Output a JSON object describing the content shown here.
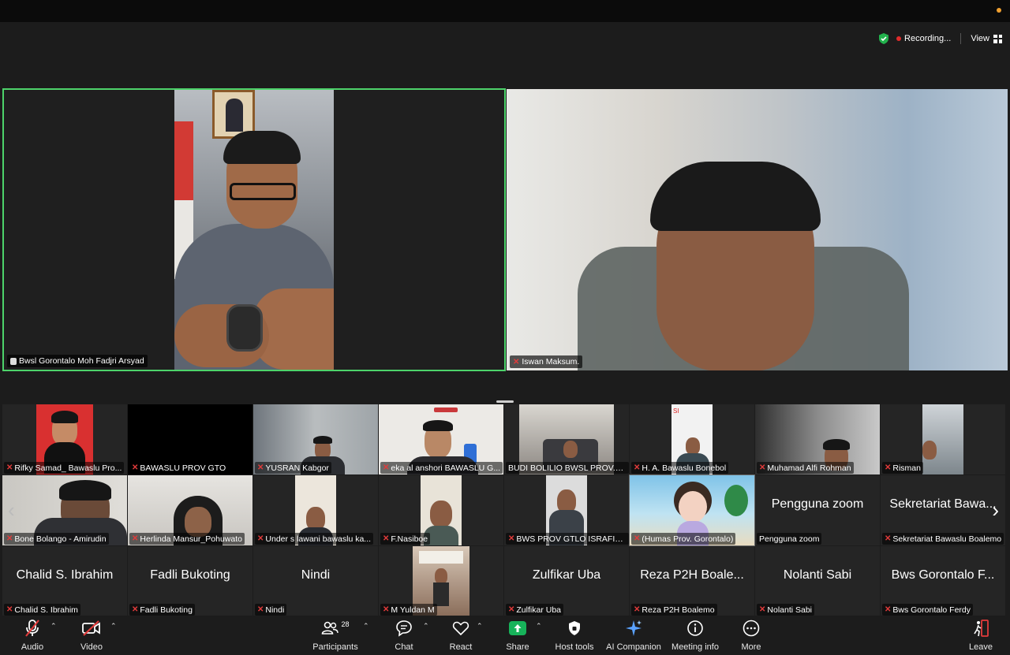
{
  "status": {
    "recording": "Recording...",
    "view": "View"
  },
  "speakers": {
    "left": {
      "name": "Bwsl Gorontalo Moh Fadjri Arsyad"
    },
    "right": {
      "name": "Iswan Maksum."
    }
  },
  "participants": [
    {
      "label": "Rifky Samad_ Bawaslu Pro..."
    },
    {
      "label": "BAWASLU PROV GTO"
    },
    {
      "label": "YUSRAN Kabgor"
    },
    {
      "label": "eka al anshori BAWASLU G..."
    },
    {
      "label": "BUDI BOLILIO BWSL PROV.G..."
    },
    {
      "label": "H. A. Bawaslu Bonebol"
    },
    {
      "label": "Muhamad Alfi Rohman"
    },
    {
      "label": "Risman"
    },
    {
      "label": "Bone Bolango - Amirudin"
    },
    {
      "label": "Herlinda Mansur_Pohuwato"
    },
    {
      "label": "Under s lawani bawaslu ka..."
    },
    {
      "label": "F.Nasiboe"
    },
    {
      "label": "BWS PROV GTLO ISRAFIEL..."
    },
    {
      "label": "(Humas Prov. Gorontalo)"
    },
    {
      "label": "Pengguna zoom",
      "display": "Pengguna zoom"
    },
    {
      "label": "Sekretariat Bawaslu Boalemo",
      "display": "Sekretariat Bawa..."
    },
    {
      "label": "Chalid S. Ibrahim",
      "display": "Chalid S. Ibrahim"
    },
    {
      "label": "Fadli Bukoting",
      "display": "Fadli Bukoting"
    },
    {
      "label": "Nindi",
      "display": "Nindi"
    },
    {
      "label": "M Yuldan M"
    },
    {
      "label": "Zulfikar Uba",
      "display": "Zulfikar Uba"
    },
    {
      "label": "Reza P2H Boalemo",
      "display": "Reza P2H Boale..."
    },
    {
      "label": "Nolanti Sabi",
      "display": "Nolanti Sabi"
    },
    {
      "label": "Bws Gorontalo Ferdy",
      "display": "Bws Gorontalo F..."
    }
  ],
  "toolbar": {
    "audio": "Audio",
    "video": "Video",
    "participants": "Participants",
    "participant_count": "28",
    "chat": "Chat",
    "react": "React",
    "share": "Share",
    "host_tools": "Host tools",
    "ai_companion": "AI Companion",
    "meeting_info": "Meeting info",
    "more": "More",
    "leave": "Leave"
  },
  "colors": {
    "active_speaker_border": "#4dd36a",
    "share_green": "#17b35a",
    "recording_red": "#e02b2b",
    "muted_red": "#e23b3b"
  }
}
